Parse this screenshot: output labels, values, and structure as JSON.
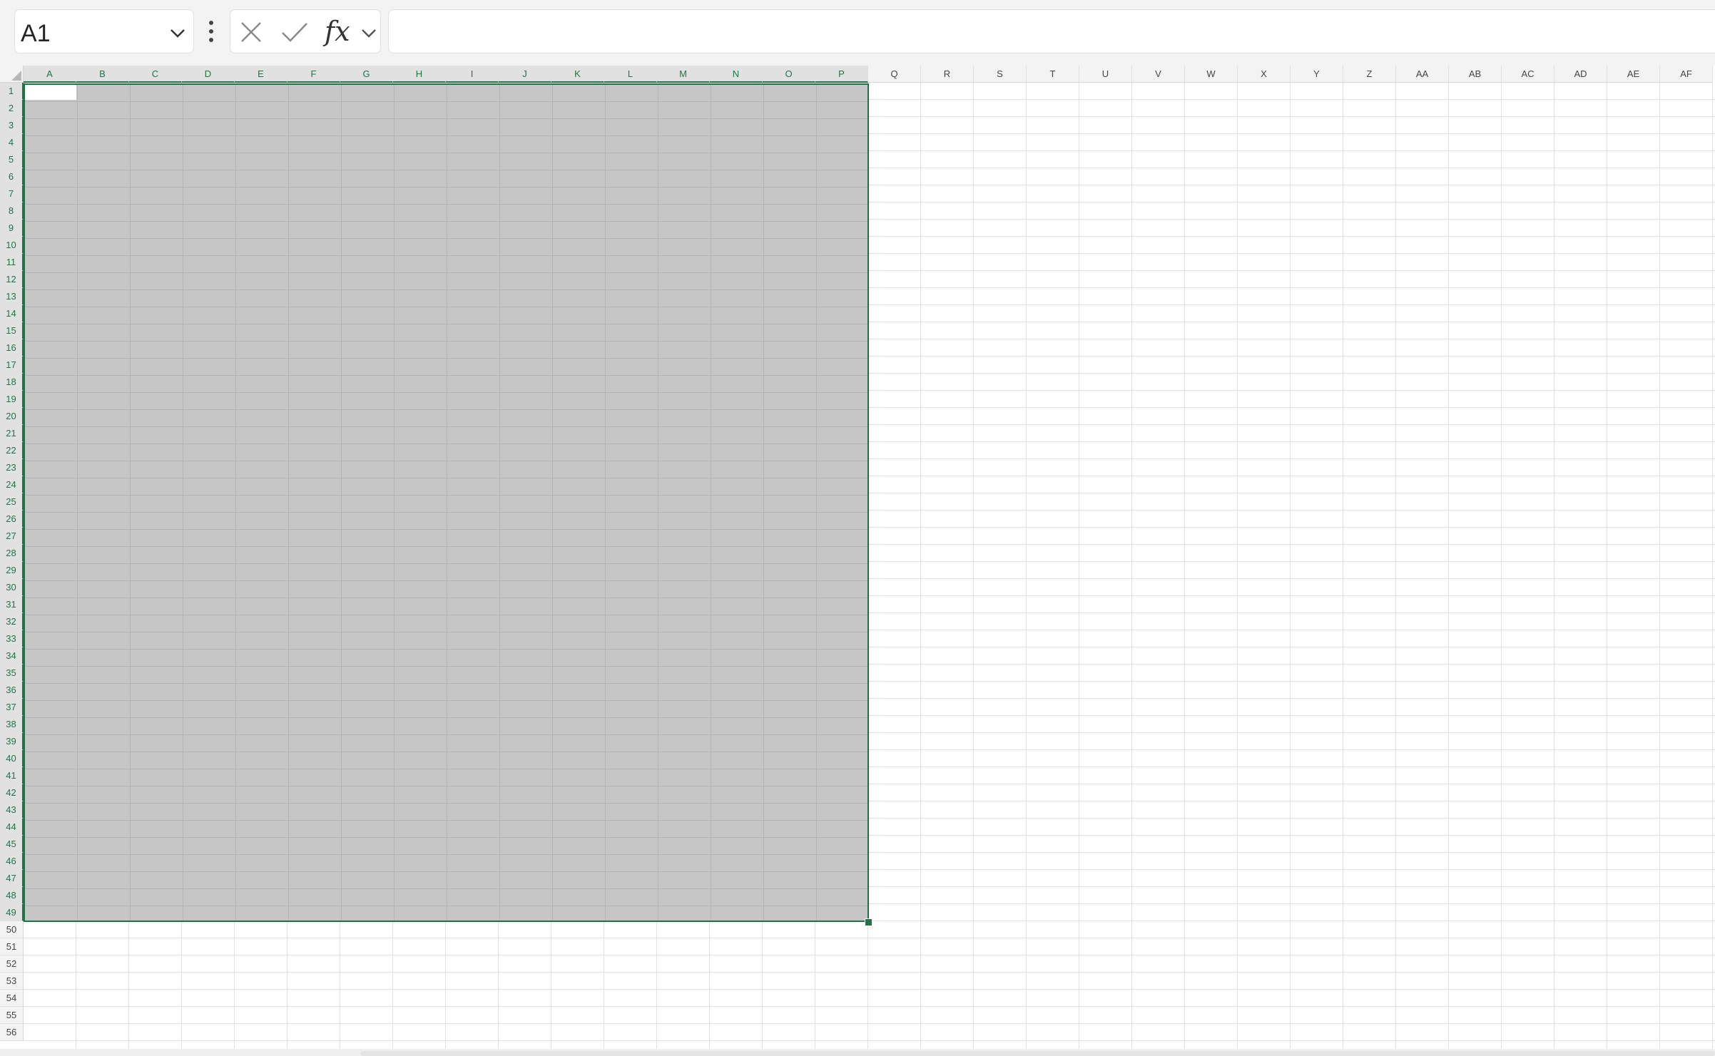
{
  "name_box": {
    "value": "A1"
  },
  "formula_bar": {
    "cancel_icon": "close-icon",
    "enter_icon": "check-icon",
    "function_label": "fx",
    "formula_value": ""
  },
  "sheet": {
    "columns": [
      "A",
      "B",
      "C",
      "D",
      "E",
      "F",
      "G",
      "H",
      "I",
      "J",
      "K",
      "L",
      "M",
      "N",
      "O",
      "P",
      "Q",
      "R",
      "S",
      "T",
      "U",
      "V",
      "W",
      "X",
      "Y",
      "Z",
      "AA",
      "AB",
      "AC",
      "AD",
      "AE",
      "AF"
    ],
    "rows": [
      "1",
      "2",
      "3",
      "4",
      "5",
      "6",
      "7",
      "8",
      "9",
      "10",
      "11",
      "12",
      "13",
      "14",
      "15",
      "16",
      "17",
      "18",
      "19",
      "20",
      "21",
      "22",
      "23",
      "24",
      "25",
      "26",
      "27",
      "28",
      "29",
      "30",
      "31",
      "32",
      "33",
      "34",
      "35",
      "36",
      "37",
      "38",
      "39",
      "40",
      "41",
      "42",
      "43",
      "44",
      "45",
      "46",
      "47",
      "48",
      "49",
      "50",
      "51",
      "52",
      "53",
      "54",
      "55",
      "56"
    ],
    "selection": {
      "range": "A1:P49",
      "active_cell": "A1"
    }
  },
  "colors": {
    "accent": "#217346",
    "selection_fill": "#c6c6c6",
    "header_bg": "#f3f3f3"
  }
}
